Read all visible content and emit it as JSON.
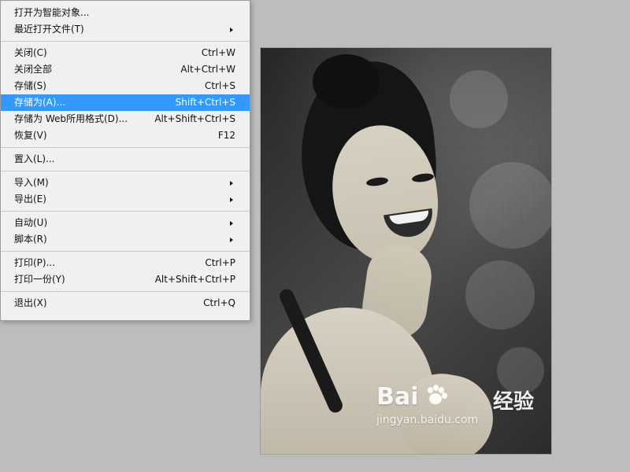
{
  "menu": {
    "items": [
      {
        "type": "item",
        "label": "打开为智能对象...",
        "shortcut": "",
        "submenu": false,
        "selected": false
      },
      {
        "type": "item",
        "label": "最近打开文件(T)",
        "shortcut": "",
        "submenu": true,
        "selected": false
      },
      {
        "type": "separator"
      },
      {
        "type": "item",
        "label": "关闭(C)",
        "shortcut": "Ctrl+W",
        "submenu": false,
        "selected": false
      },
      {
        "type": "item",
        "label": "关闭全部",
        "shortcut": "Alt+Ctrl+W",
        "submenu": false,
        "selected": false
      },
      {
        "type": "item",
        "label": "存储(S)",
        "shortcut": "Ctrl+S",
        "submenu": false,
        "selected": false
      },
      {
        "type": "item",
        "label": "存储为(A)...",
        "shortcut": "Shift+Ctrl+S",
        "submenu": false,
        "selected": true
      },
      {
        "type": "item",
        "label": "存储为 Web所用格式(D)...",
        "shortcut": "Alt+Shift+Ctrl+S",
        "submenu": false,
        "selected": false
      },
      {
        "type": "item",
        "label": "恢复(V)",
        "shortcut": "F12",
        "submenu": false,
        "selected": false
      },
      {
        "type": "separator"
      },
      {
        "type": "item",
        "label": "置入(L)...",
        "shortcut": "",
        "submenu": false,
        "selected": false
      },
      {
        "type": "separator"
      },
      {
        "type": "item",
        "label": "导入(M)",
        "shortcut": "",
        "submenu": true,
        "selected": false
      },
      {
        "type": "item",
        "label": "导出(E)",
        "shortcut": "",
        "submenu": true,
        "selected": false
      },
      {
        "type": "separator"
      },
      {
        "type": "item",
        "label": "自动(U)",
        "shortcut": "",
        "submenu": true,
        "selected": false
      },
      {
        "type": "item",
        "label": "脚本(R)",
        "shortcut": "",
        "submenu": true,
        "selected": false
      },
      {
        "type": "separator"
      },
      {
        "type": "item",
        "label": "打印(P)...",
        "shortcut": "Ctrl+P",
        "submenu": false,
        "selected": false
      },
      {
        "type": "item",
        "label": "打印一份(Y)",
        "shortcut": "Alt+Shift+Ctrl+P",
        "submenu": false,
        "selected": false
      },
      {
        "type": "separator"
      },
      {
        "type": "item",
        "label": "退出(X)",
        "shortcut": "Ctrl+Q",
        "submenu": false,
        "selected": false
      }
    ]
  },
  "watermark": {
    "brand_left": "Bai",
    "brand_right": "经验",
    "url": "jingyan.baidu.com"
  },
  "colors": {
    "menu_bg": "#f0f0f0",
    "menu_selected": "#3399ff",
    "workspace_bg": "#bdbdbd"
  }
}
